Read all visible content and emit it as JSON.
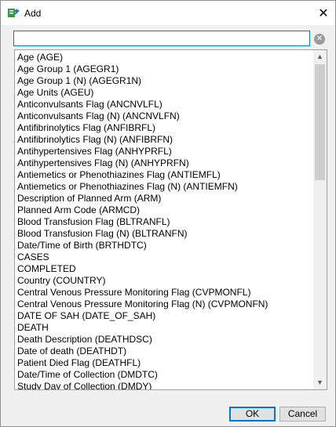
{
  "window": {
    "title": "Add",
    "close_glyph": "✕"
  },
  "search": {
    "value": "",
    "placeholder": "",
    "clear_icon": "clear-search-icon"
  },
  "list": {
    "items": [
      "Age (AGE)",
      "Age Group 1 (AGEGR1)",
      "Age Group 1 (N) (AGEGR1N)",
      "Age Units (AGEU)",
      "Anticonvulsants Flag (ANCNVLFL)",
      "Anticonvulsants Flag (N) (ANCNVLFN)",
      "Antifibrinolytics Flag (ANFIBRFL)",
      "Antifibrinolytics Flag (N) (ANFIBRFN)",
      "Antihypertensives Flag (ANHYPRFL)",
      "Antihypertensives Flag (N) (ANHYPRFN)",
      "Antiemetics or Phenothiazines Flag (ANTIEMFL)",
      "Antiemetics or Phenothiazines Flag (N) (ANTIEMFN)",
      "Description of Planned Arm (ARM)",
      "Planned Arm Code (ARMCD)",
      "Blood Transfusion Flag (BLTRANFL)",
      "Blood Transfusion Flag (N) (BLTRANFN)",
      "Date/Time of Birth (BRTHDTC)",
      "CASES",
      "COMPLETED",
      "Country (COUNTRY)",
      "Central Venous Pressure Monitoring Flag (CVPMONFL)",
      "Central Venous Pressure Monitoring Flag (N) (CVPMONFN)",
      "DATE OF SAH (DATE_OF_SAH)",
      "DEATH",
      "Death Description (DEATHDSC)",
      "Date of death (DEATHDT)",
      "Patient Died Flag (DEATHFL)",
      "Date/Time of Collection (DMDTC)",
      "Study Day of Collection (DMDY)"
    ]
  },
  "buttons": {
    "ok": "OK",
    "cancel": "Cancel"
  },
  "colors": {
    "focus_border": "#0078d7",
    "title_icon_green": "#2e9e3e"
  }
}
